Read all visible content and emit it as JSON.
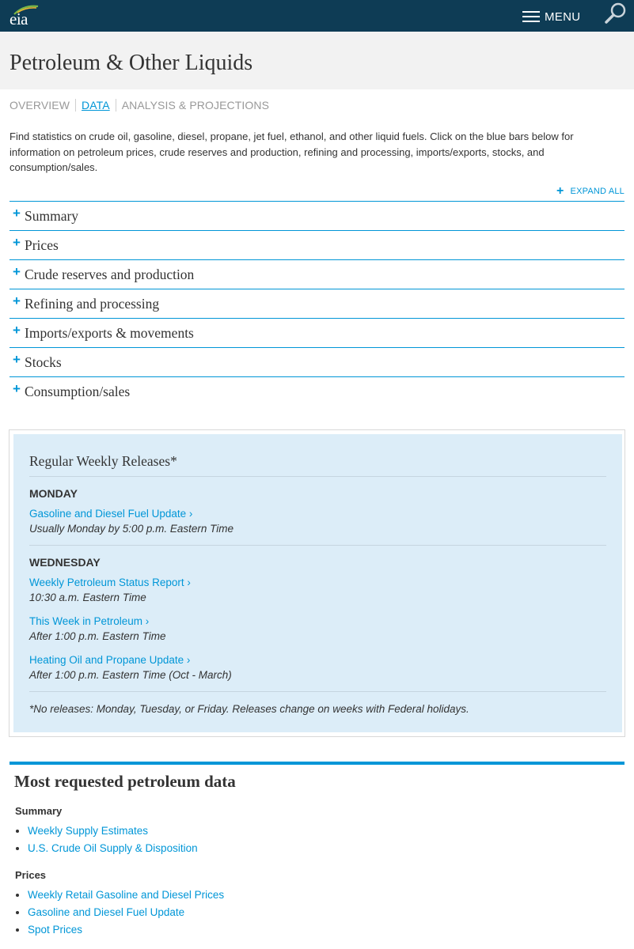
{
  "header": {
    "logo_text": "eia",
    "menu_label": "MENU",
    "brand_color": "#0e3c55",
    "accent_color": "#0096d7"
  },
  "page": {
    "title": "Petroleum & Other Liquids"
  },
  "subnav": {
    "tabs": [
      {
        "label": "OVERVIEW",
        "active": false
      },
      {
        "label": "DATA",
        "active": true
      },
      {
        "label": "ANALYSIS & PROJECTIONS",
        "active": false
      }
    ]
  },
  "intro": {
    "text": "Find statistics on crude oil, gasoline, diesel, propane, jet fuel, ethanol, and other liquid fuels. Click on the blue bars below for information on petroleum prices, crude reserves and production, refining and processing, imports/exports, stocks, and consumption/sales."
  },
  "accordion": {
    "expand_all_label": "EXPAND ALL",
    "items": [
      {
        "label": "Summary"
      },
      {
        "label": "Prices"
      },
      {
        "label": "Crude reserves and production"
      },
      {
        "label": "Refining and processing"
      },
      {
        "label": "Imports/exports & movements"
      },
      {
        "label": "Stocks"
      },
      {
        "label": "Consumption/sales"
      }
    ]
  },
  "weekly_releases": {
    "title": "Regular Weekly Releases*",
    "monday": {
      "day": "MONDAY",
      "releases": [
        {
          "link": "Gasoline and Diesel Fuel Update ›",
          "time": "Usually Monday by 5:00 p.m. Eastern Time"
        }
      ]
    },
    "wednesday": {
      "day": "WEDNESDAY",
      "releases": [
        {
          "link": "Weekly Petroleum Status Report ›",
          "time": "10:30 a.m. Eastern Time"
        },
        {
          "link": "This Week in Petroleum ›",
          "time": "After 1:00 p.m. Eastern Time"
        },
        {
          "link": "Heating Oil and Propane Update ›",
          "time": "After 1:00 p.m. Eastern Time (Oct - March)"
        }
      ]
    },
    "note": "*No releases: Monday, Tuesday, or Friday. Releases change on weeks with Federal holidays."
  },
  "most_requested": {
    "title": "Most requested petroleum data",
    "sections": [
      {
        "heading": "Summary",
        "links": [
          "Weekly Supply Estimates",
          "U.S. Crude Oil Supply & Disposition"
        ]
      },
      {
        "heading": "Prices",
        "links": [
          "Weekly Retail Gasoline and Diesel Prices",
          "Gasoline and Diesel Fuel Update",
          "Spot Prices"
        ]
      }
    ]
  }
}
